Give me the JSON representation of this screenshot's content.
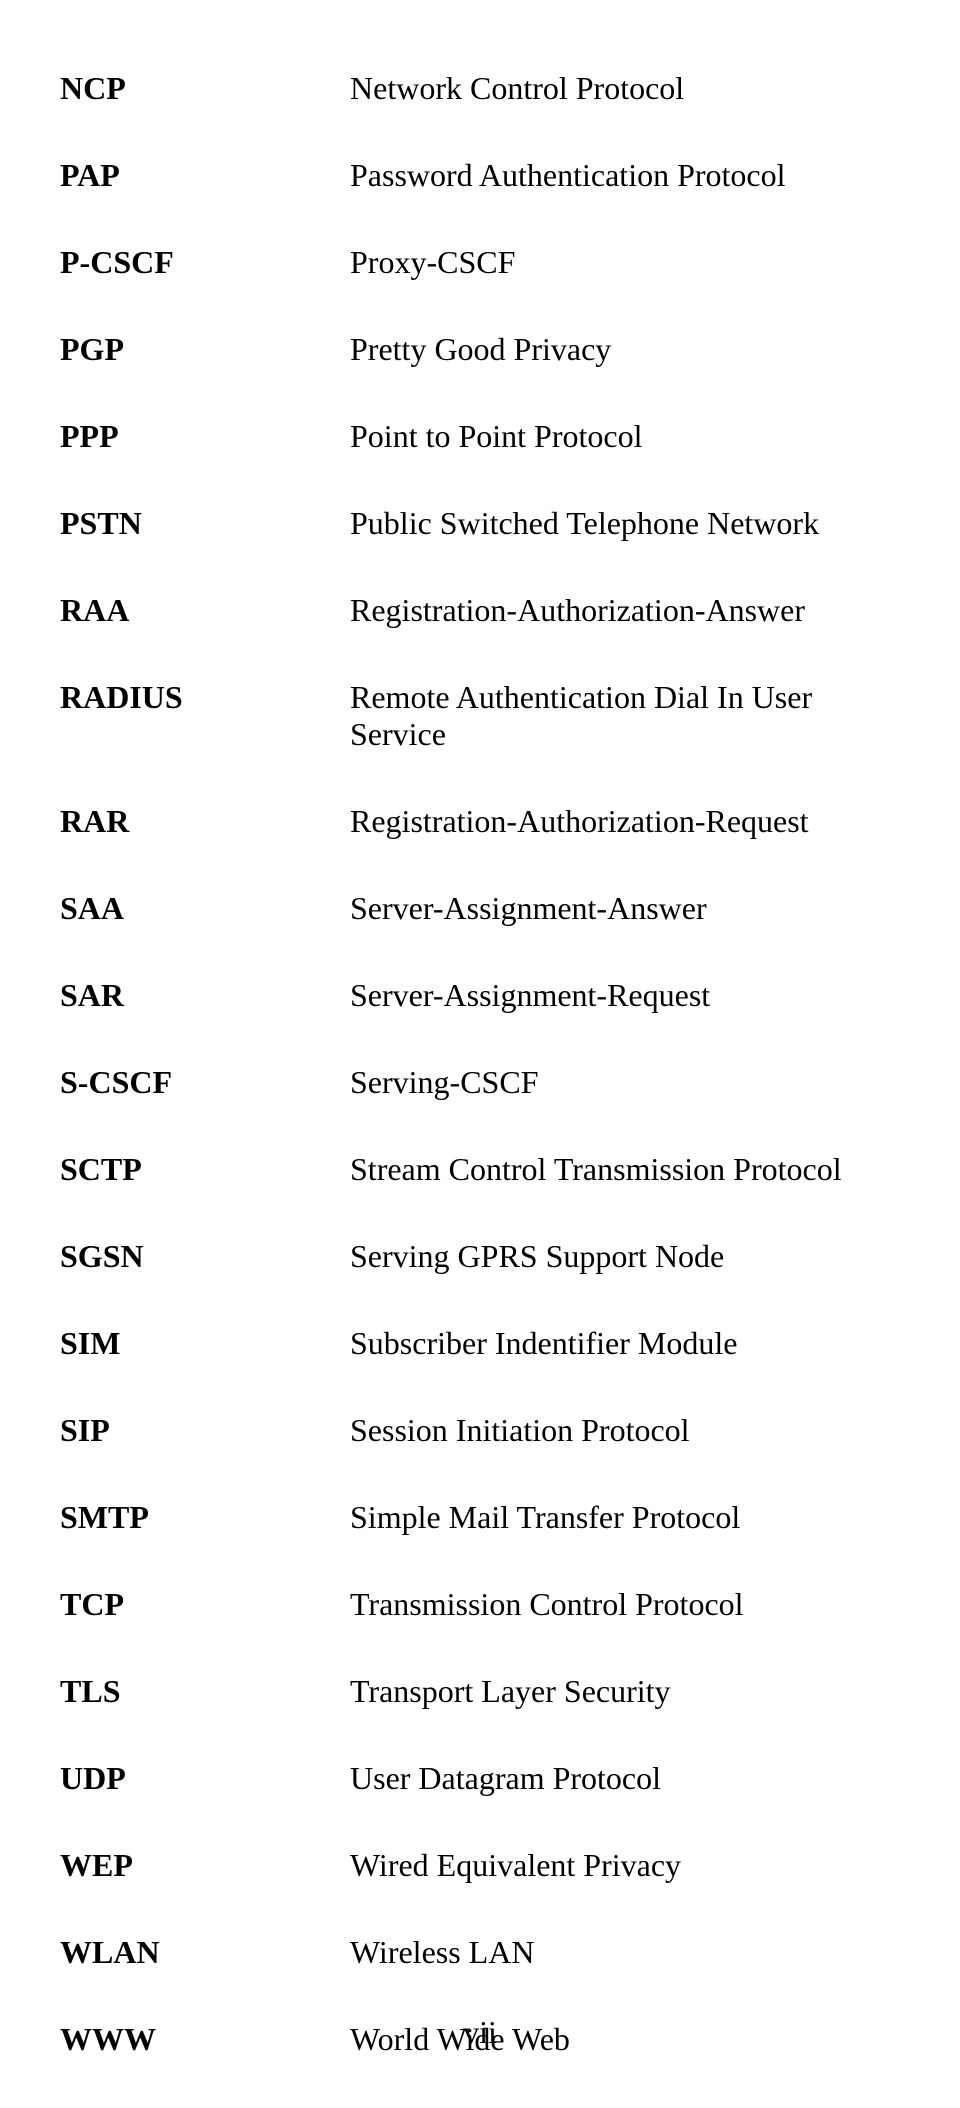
{
  "entries": [
    {
      "abbr": "NCP",
      "def": "Network Control Protocol"
    },
    {
      "abbr": "PAP",
      "def": "Password Authentication Protocol"
    },
    {
      "abbr": "P-CSCF",
      "def": "Proxy-CSCF"
    },
    {
      "abbr": "PGP",
      "def": "Pretty Good Privacy"
    },
    {
      "abbr": "PPP",
      "def": "Point to Point Protocol"
    },
    {
      "abbr": "PSTN",
      "def": "Public Switched Telephone Network"
    },
    {
      "abbr": "RAA",
      "def": "Registration-Authorization-Answer"
    },
    {
      "abbr": "RADIUS",
      "def": "Remote Authentication Dial In User Service"
    },
    {
      "abbr": "RAR",
      "def": "Registration-Authorization-Request"
    },
    {
      "abbr": "SAA",
      "def": "Server-Assignment-Answer"
    },
    {
      "abbr": "SAR",
      "def": "Server-Assignment-Request"
    },
    {
      "abbr": "S-CSCF",
      "def": "Serving-CSCF"
    },
    {
      "abbr": "SCTP",
      "def": "Stream Control Transmission Protocol"
    },
    {
      "abbr": "SGSN",
      "def": "Serving GPRS Support Node"
    },
    {
      "abbr": "SIM",
      "def": "Subscriber Indentifier Module"
    },
    {
      "abbr": "SIP",
      "def": "Session Initiation Protocol"
    },
    {
      "abbr": "SMTP",
      "def": "Simple Mail Transfer Protocol"
    },
    {
      "abbr": "TCP",
      "def": "Transmission Control Protocol"
    },
    {
      "abbr": "TLS",
      "def": "Transport Layer Security"
    },
    {
      "abbr": "UDP",
      "def": "User Datagram Protocol"
    },
    {
      "abbr": "WEP",
      "def": "Wired Equivalent Privacy"
    },
    {
      "abbr": "WLAN",
      "def": "Wireless LAN"
    },
    {
      "abbr": "WWW",
      "def": "World Wide Web"
    }
  ],
  "page_number": "vii"
}
